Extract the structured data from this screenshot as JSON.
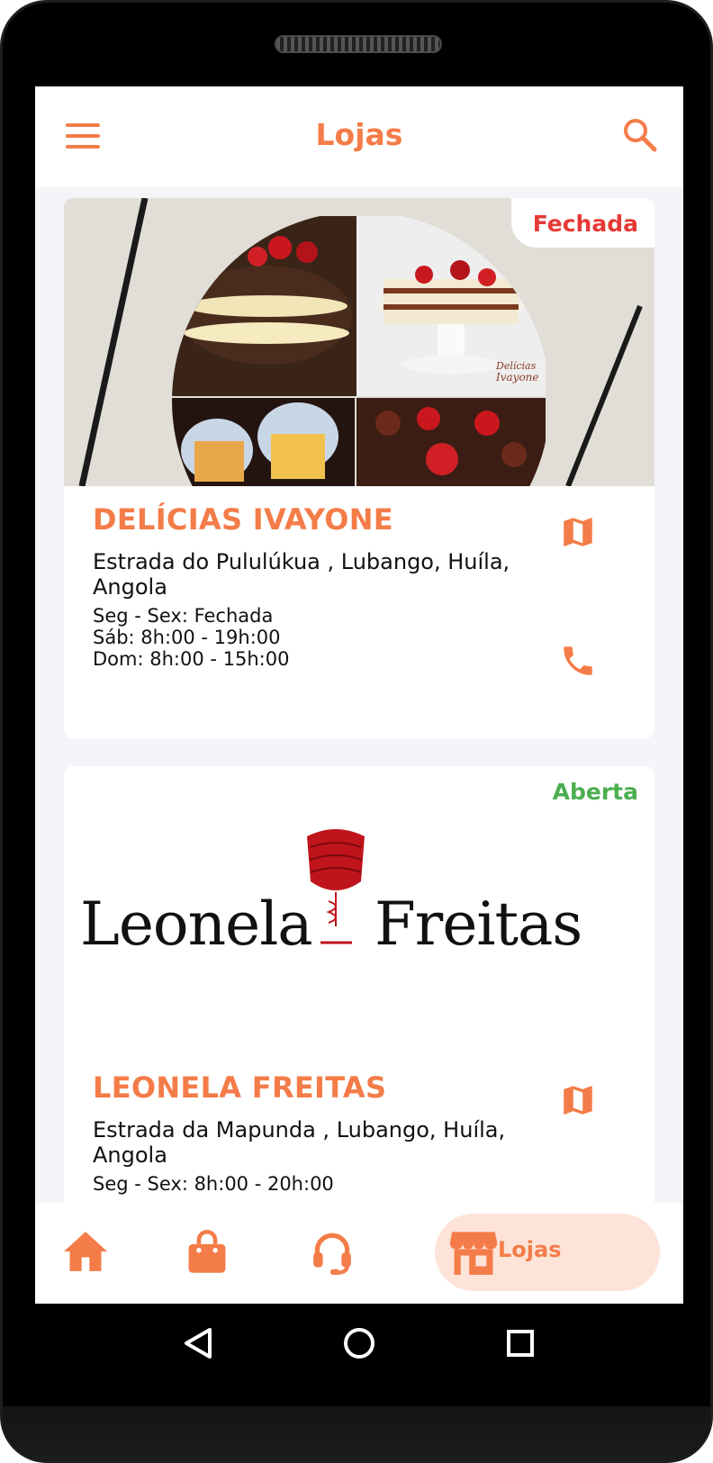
{
  "header": {
    "title": "Lojas"
  },
  "stores": [
    {
      "status": "Fechada",
      "status_color": "#e53935",
      "name": "DELÍCIAS IVAYONE",
      "address": "Estrada do Pululúkua  , Lubango, Huíla, Angola",
      "hours": [
        "Seg - Sex: Fechada",
        "Sáb: 8h:00 - 19h:00",
        "Dom: 8h:00 - 15h:00"
      ],
      "image_text": [
        "Delícias",
        "Ivayone"
      ]
    },
    {
      "status": "Aberta",
      "status_color": "#4caf50",
      "name": "LEONELA FREITAS",
      "address": "Estrada da Mapunda , Lubango, Huíla, Angola",
      "hours": [
        "Seg - Sex: 8h:00 - 20h:00"
      ],
      "logo_text": [
        "Leonela",
        "Freitas"
      ]
    }
  ],
  "bottom_nav": {
    "items": [
      "home-icon",
      "shopping-bag-icon",
      "support-headset-icon",
      "store-icon"
    ],
    "active_label": "Lojas"
  },
  "colors": {
    "accent": "#f47c48",
    "active_bg": "#fde3d8",
    "background": "#f4f5f9"
  }
}
